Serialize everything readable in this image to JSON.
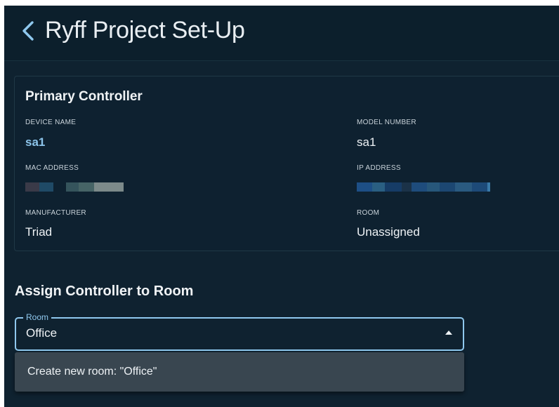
{
  "header": {
    "title": "Ryff Project Set-Up",
    "back_icon": "chevron-left-icon"
  },
  "controller_card": {
    "title": "Primary Controller",
    "fields": {
      "device_name": {
        "label": "DEVICE NAME",
        "value": "sa1"
      },
      "model_number": {
        "label": "MODEL NUMBER",
        "value": "sa1"
      },
      "mac_address": {
        "label": "MAC ADDRESS",
        "value": ""
      },
      "ip_address": {
        "label": "IP ADDRESS",
        "value": ""
      },
      "manufacturer": {
        "label": "MANUFACTURER",
        "value": "Triad"
      },
      "room": {
        "label": "ROOM",
        "value": "Unassigned"
      }
    }
  },
  "assign_section": {
    "title": "Assign Controller to Room",
    "room_select": {
      "label": "Room",
      "value": "Office",
      "caret_icon": "caret-up-icon"
    },
    "dropdown": {
      "items": [
        {
          "label": "Create new room: \"Office\""
        }
      ]
    }
  },
  "colors": {
    "background": "#0f2230",
    "header_background": "#0c1f2c",
    "accent": "#8fc8ee",
    "link": "#8cc4ea",
    "dropdown_background": "#394650",
    "text": "#eef2f5"
  }
}
